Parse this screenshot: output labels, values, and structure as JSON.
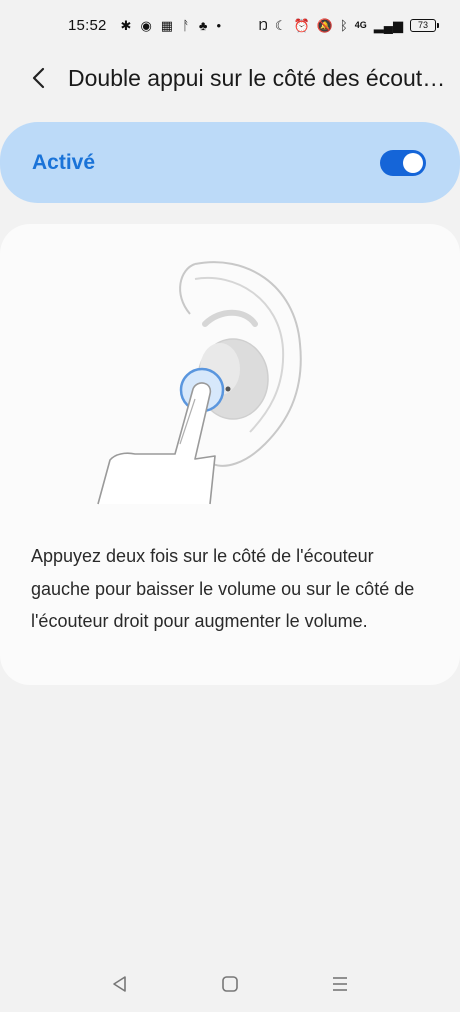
{
  "status_bar": {
    "time": "15:52",
    "left_icons": [
      "slack-icon",
      "chat-icon",
      "qr-icon",
      "app-icon",
      "duck-icon",
      "dot-icon"
    ],
    "right_icons": [
      "nfc-icon",
      "moon-icon",
      "alarm-icon",
      "mute-icon",
      "bluetooth-icon",
      "signal-4g-icon",
      "wifi-icon"
    ],
    "signal_label": "4G",
    "battery": "73"
  },
  "header": {
    "title": "Double appui sur le côté des écouteurs"
  },
  "toggle": {
    "label": "Activé",
    "state": "on",
    "accent_color": "#1565d8"
  },
  "card": {
    "description": "Appuyez deux fois sur le côté de l'écouteur gauche pour baisser le volume ou sur le côté de l'écouteur droit pour augmenter le volume."
  },
  "nav": {
    "icons": [
      "back-nav-icon",
      "home-nav-icon",
      "recents-nav-icon"
    ]
  }
}
